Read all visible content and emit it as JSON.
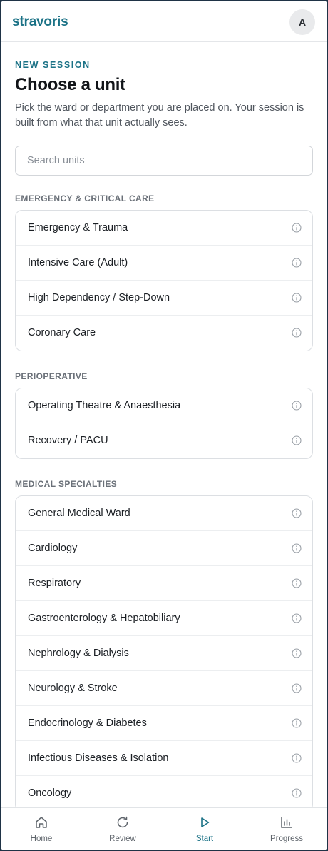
{
  "app": {
    "brand": "stravoris",
    "avatar_initial": "A"
  },
  "page": {
    "eyebrow": "NEW SESSION",
    "title": "Choose a unit",
    "subtitle": "Pick the ward or department you are placed on. Your session is built from what that unit actually sees."
  },
  "search": {
    "placeholder": "Search units",
    "value": ""
  },
  "sections": [
    {
      "label": "EMERGENCY & CRITICAL CARE",
      "units": [
        "Emergency & Trauma",
        "Intensive Care (Adult)",
        "High Dependency / Step-Down",
        "Coronary Care"
      ]
    },
    {
      "label": "PERIOPERATIVE",
      "units": [
        "Operating Theatre & Anaesthesia",
        "Recovery / PACU"
      ]
    },
    {
      "label": "MEDICAL SPECIALTIES",
      "units": [
        "General Medical Ward",
        "Cardiology",
        "Respiratory",
        "Gastroenterology & Hepatobiliary",
        "Nephrology & Dialysis",
        "Neurology & Stroke",
        "Endocrinology & Diabetes",
        "Infectious Diseases & Isolation",
        "Oncology"
      ]
    }
  ],
  "nav": {
    "items": [
      {
        "label": "Home",
        "icon": "home-icon"
      },
      {
        "label": "Review",
        "icon": "refresh-icon"
      },
      {
        "label": "Start",
        "icon": "play-icon",
        "active": true
      },
      {
        "label": "Progress",
        "icon": "bar-chart-icon"
      }
    ]
  },
  "colors": {
    "accent": "#1b7286",
    "muted": "#6a7078",
    "border": "#dcdfe3"
  }
}
